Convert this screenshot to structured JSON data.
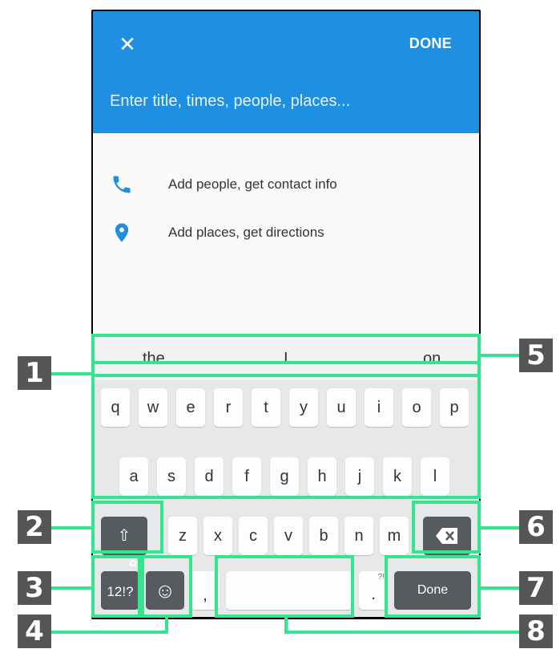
{
  "header": {
    "close_icon": "x-icon",
    "done_label": "DONE",
    "title_placeholder": "Enter title, times, people, places..."
  },
  "rows": [
    {
      "icon": "phone-icon",
      "label": "Add people, get contact info"
    },
    {
      "icon": "location-pin-icon",
      "label": "Add places, get directions"
    }
  ],
  "keyboard": {
    "suggestions": [
      "the",
      "I",
      "on"
    ],
    "row1": [
      "q",
      "w",
      "e",
      "r",
      "t",
      "y",
      "u",
      "i",
      "o",
      "p"
    ],
    "row2": [
      "a",
      "s",
      "d",
      "f",
      "g",
      "h",
      "j",
      "k",
      "l"
    ],
    "row3": [
      "z",
      "x",
      "c",
      "v",
      "b",
      "n",
      "m"
    ],
    "shift_symbol": "⇧",
    "symbols_label": "12!?",
    "emoji_symbol": "☺",
    "comma": ",",
    "period": ".",
    "period_alt": "?!",
    "done_label": "Done"
  },
  "callouts": [
    "1",
    "2",
    "3",
    "4",
    "5",
    "6",
    "7",
    "8"
  ],
  "colors": {
    "accent": "#1e8fe1",
    "highlight": "#34e58f",
    "badge": "#555555"
  }
}
